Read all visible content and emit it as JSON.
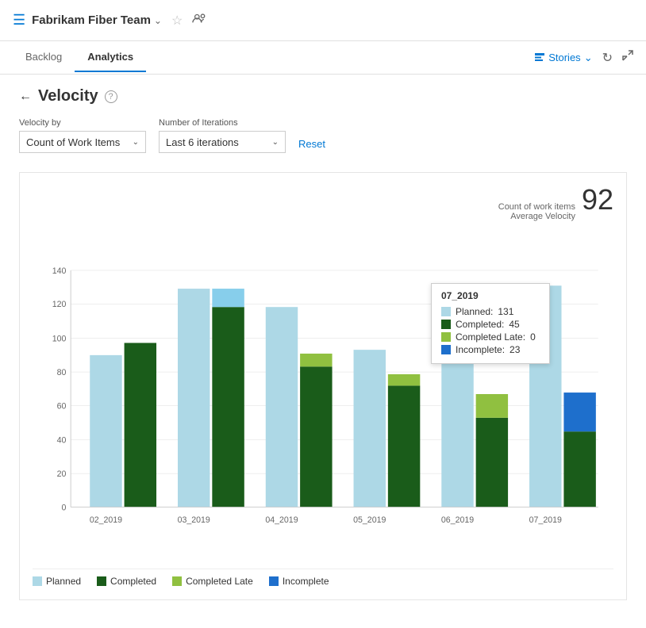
{
  "app": {
    "icon": "☰",
    "team_name": "Fabrikam Fiber Team",
    "chevron": "⌄",
    "star": "☆",
    "people_icon": "⚇"
  },
  "nav": {
    "tabs": [
      {
        "id": "backlog",
        "label": "Backlog",
        "active": false
      },
      {
        "id": "analytics",
        "label": "Analytics",
        "active": true
      }
    ],
    "stories_label": "Stories",
    "stories_chevron": "⌄",
    "refresh_icon": "↻",
    "expand_icon": "⤢"
  },
  "page": {
    "back_icon": "←",
    "title": "Velocity",
    "help_icon": "?",
    "velocity_by_label": "Velocity by",
    "velocity_by_value": "Count of Work Items",
    "iterations_label": "Number of Iterations",
    "iterations_value": "Last 6 iterations",
    "reset_label": "Reset"
  },
  "chart": {
    "count_label": "Count of work items",
    "avg_velocity_label": "Average Velocity",
    "avg_velocity_value": "92",
    "y_labels": [
      "0",
      "20",
      "40",
      "60",
      "80",
      "100",
      "120",
      "140"
    ],
    "bars": [
      {
        "sprint": "02_2019",
        "planned": 90,
        "completed": 97,
        "completed_late": 0,
        "incomplete": 0
      },
      {
        "sprint": "03_2019",
        "planned": 129,
        "completed": 118,
        "completed_late": 0,
        "incomplete": 0
      },
      {
        "sprint": "04_2019",
        "planned": 118,
        "completed": 83,
        "completed_late": 8,
        "incomplete": 0
      },
      {
        "sprint": "05_2019",
        "planned": 93,
        "completed": 72,
        "completed_late": 7,
        "incomplete": 0
      },
      {
        "sprint": "06_2019",
        "planned": 89,
        "completed": 53,
        "completed_late": 14,
        "incomplete": 0
      },
      {
        "sprint": "07_2019",
        "planned": 131,
        "completed": 45,
        "completed_late": 0,
        "incomplete": 23
      }
    ],
    "tooltip": {
      "sprint": "07_2019",
      "planned_label": "Planned:",
      "planned_value": "131",
      "completed_label": "Completed:",
      "completed_value": "45",
      "completed_late_label": "Completed Late:",
      "completed_late_value": "0",
      "incomplete_label": "Incomplete:",
      "incomplete_value": "23"
    },
    "legend": [
      {
        "id": "planned",
        "label": "Planned",
        "color": "#add8e6"
      },
      {
        "id": "completed",
        "label": "Completed",
        "color": "#1a5c1a"
      },
      {
        "id": "completed_late",
        "label": "Completed Late",
        "color": "#90c040"
      },
      {
        "id": "incomplete",
        "label": "Incomplete",
        "color": "#1e6fcc"
      }
    ]
  }
}
